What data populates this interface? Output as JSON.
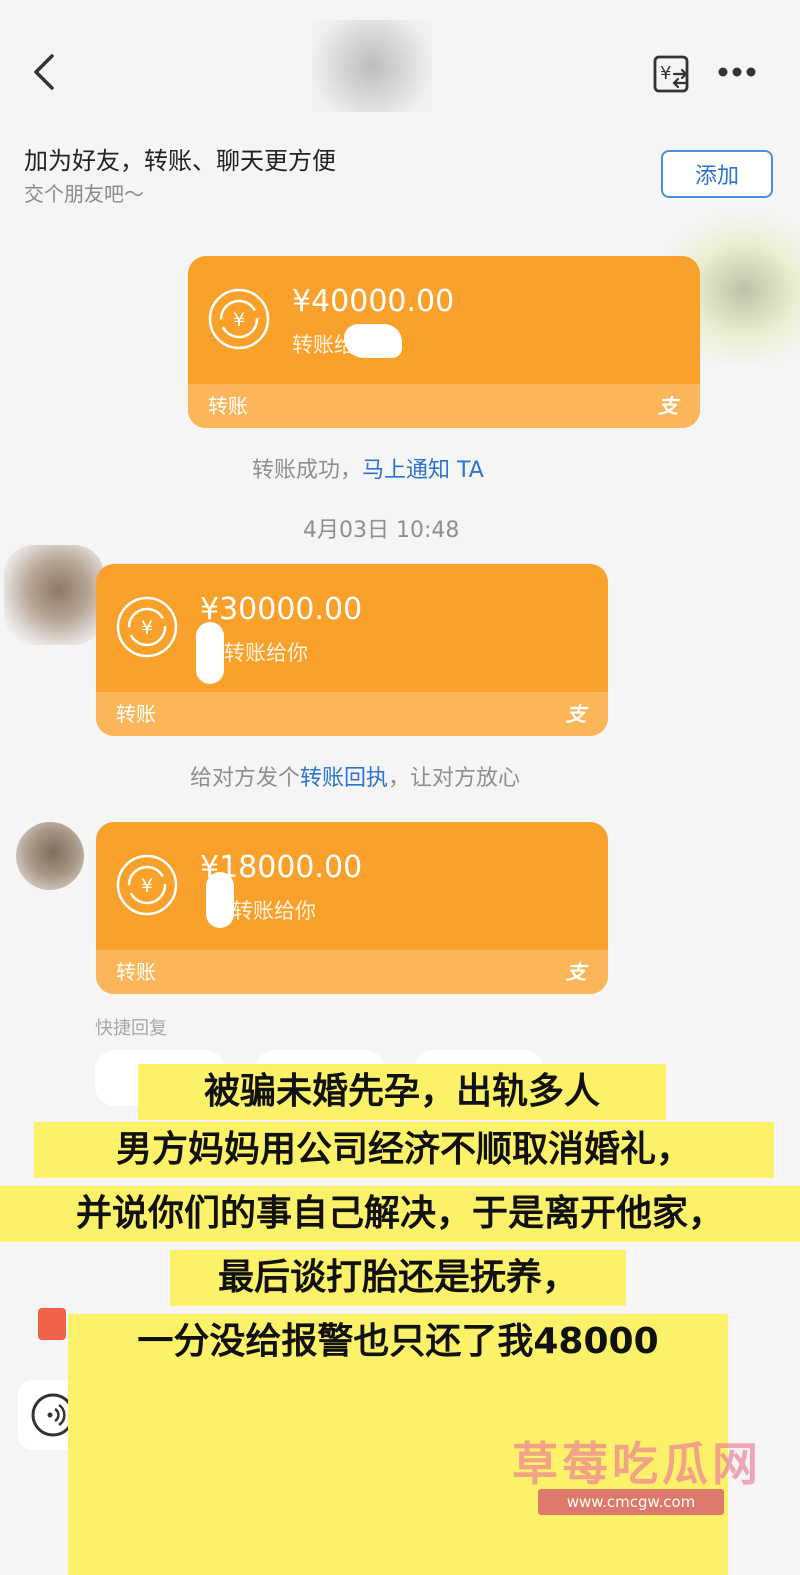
{
  "header": {
    "back_icon": "chevron-left-icon",
    "transfer_icon": "yuan-exchange-icon",
    "more_icon": "more-dots-icon"
  },
  "banner": {
    "title": "加为好友，转账、聊天更方便",
    "subtitle": "交个朋友吧～",
    "add_button": "添加"
  },
  "messages": {
    "transfer_1": {
      "amount": "¥40000.00",
      "note": "转账给",
      "type": "转账",
      "alipay_mark": "支"
    },
    "status_prefix": "转账成功，",
    "status_link": "马上通知 TA",
    "timestamp": "4月03日 10:48",
    "transfer_2": {
      "amount": "¥30000.00",
      "note": "转账给你",
      "type": "转账",
      "alipay_mark": "支"
    },
    "receipt_prefix": "给对方发个",
    "receipt_link": "转账回执",
    "receipt_suffix": "，让对方放心",
    "transfer_3": {
      "amount": "¥18000.00",
      "note": "转账给你",
      "type": "转账",
      "alipay_mark": "支"
    }
  },
  "quick_reply": {
    "label": "快捷回复"
  },
  "caption": {
    "line1": "被骗未婚先孕，出轨多人",
    "line2": "男方妈妈用公司经济不顺取消婚礼，",
    "line3": "并说你们的事自己解决，于是离开他家，",
    "line4": "最后谈打胎还是抚养，",
    "line5": "一分没给报警也只还了我48000"
  },
  "watermark": {
    "name": "草莓吃瓜网",
    "url": "www.cmcgw.com"
  },
  "colors": {
    "card_orange": "#f9a12b",
    "card_bottom": "#fbb65a",
    "link_blue": "#2b74d0",
    "caption_yellow": "#fcf26a"
  }
}
